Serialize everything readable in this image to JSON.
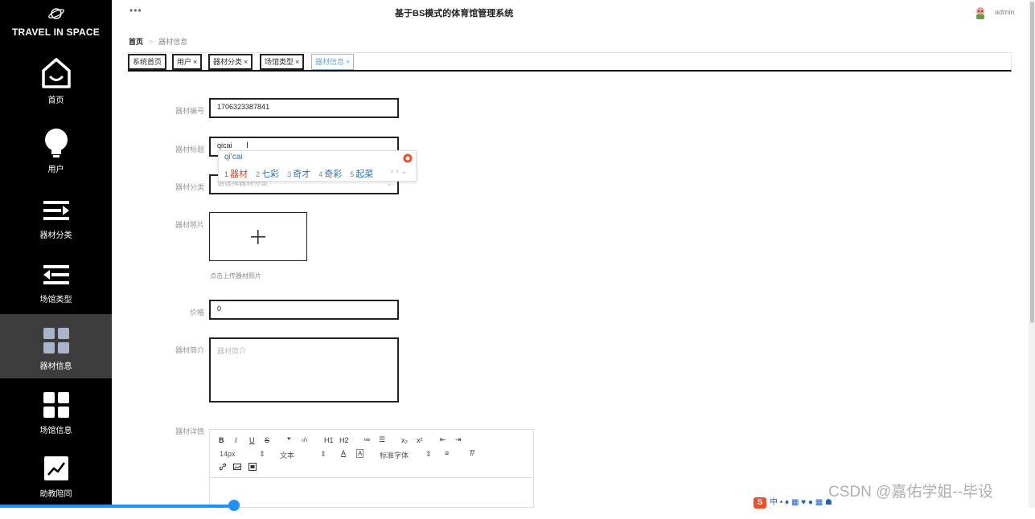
{
  "app": {
    "brand": "TRAVEL IN SPACE",
    "title": "基于BS模式的体育馆管理系统",
    "user": "admin"
  },
  "sidebar": {
    "items": [
      {
        "label": "首页",
        "icon": "home-icon"
      },
      {
        "label": "用户",
        "icon": "lightbulb-icon"
      },
      {
        "label": "器材分类",
        "icon": "list-arrow-icon"
      },
      {
        "label": "场馆类型",
        "icon": "list-back-icon"
      },
      {
        "label": "器材信息",
        "icon": "grid-icon",
        "active": true
      },
      {
        "label": "场馆信息",
        "icon": "grid-icon"
      },
      {
        "label": "助教陪同",
        "icon": "chart-line-icon"
      }
    ]
  },
  "breadcrumb": {
    "home": "首页",
    "current": "器材信息"
  },
  "tabs": [
    {
      "label": "系统首页",
      "closable": false
    },
    {
      "label": "用户",
      "closable": true
    },
    {
      "label": "器材分类",
      "closable": true
    },
    {
      "label": "场馆类型",
      "closable": true
    },
    {
      "label": "器材信息",
      "closable": true,
      "active": true
    }
  ],
  "tab_close": "×",
  "form": {
    "code": {
      "label": "器材编号",
      "value": "1706323387841"
    },
    "title": {
      "label": "器材标题",
      "value": "qicai"
    },
    "category": {
      "label": "器材分类",
      "placeholder": "请选择器材分类"
    },
    "photo": {
      "label": "器材照片",
      "hint": "点击上传器材照片",
      "plus": "+"
    },
    "price": {
      "label": "价格",
      "value": "0"
    },
    "intro": {
      "label": "器材简介",
      "placeholder": "器材简介"
    },
    "detail": {
      "label": "器材详情"
    }
  },
  "ime": {
    "input": "qi'cai",
    "candidates": [
      {
        "n": "1",
        "text": "器材"
      },
      {
        "n": "2",
        "text": "七彩"
      },
      {
        "n": "3",
        "text": "奇才"
      },
      {
        "n": "4",
        "text": "奇彩"
      },
      {
        "n": "5",
        "text": "起菜"
      }
    ],
    "nav": "‹ › ⌄"
  },
  "editor": {
    "row1": [
      "B",
      "I",
      "U",
      "S",
      "❞",
      "‹/›",
      "H1",
      "H2",
      "≔",
      "☰",
      "x₂",
      "x²",
      "⇤",
      "⇥"
    ],
    "font_size": "14px",
    "text_style": "文本",
    "font_family": "标准字体",
    "extra": [
      "A",
      "A",
      "≡",
      "T̸"
    ]
  },
  "tray": {
    "ime_label": "中",
    "icons": "• ♦ ▦ ♥ ● ▦ ☗"
  },
  "watermark": "CSDN @嘉佑学姐--毕设",
  "colors": {
    "sidebar": "#000000",
    "active_nav": "#3c3c3c",
    "accent": "#1e90ff",
    "ime_first": "#d2452a"
  }
}
